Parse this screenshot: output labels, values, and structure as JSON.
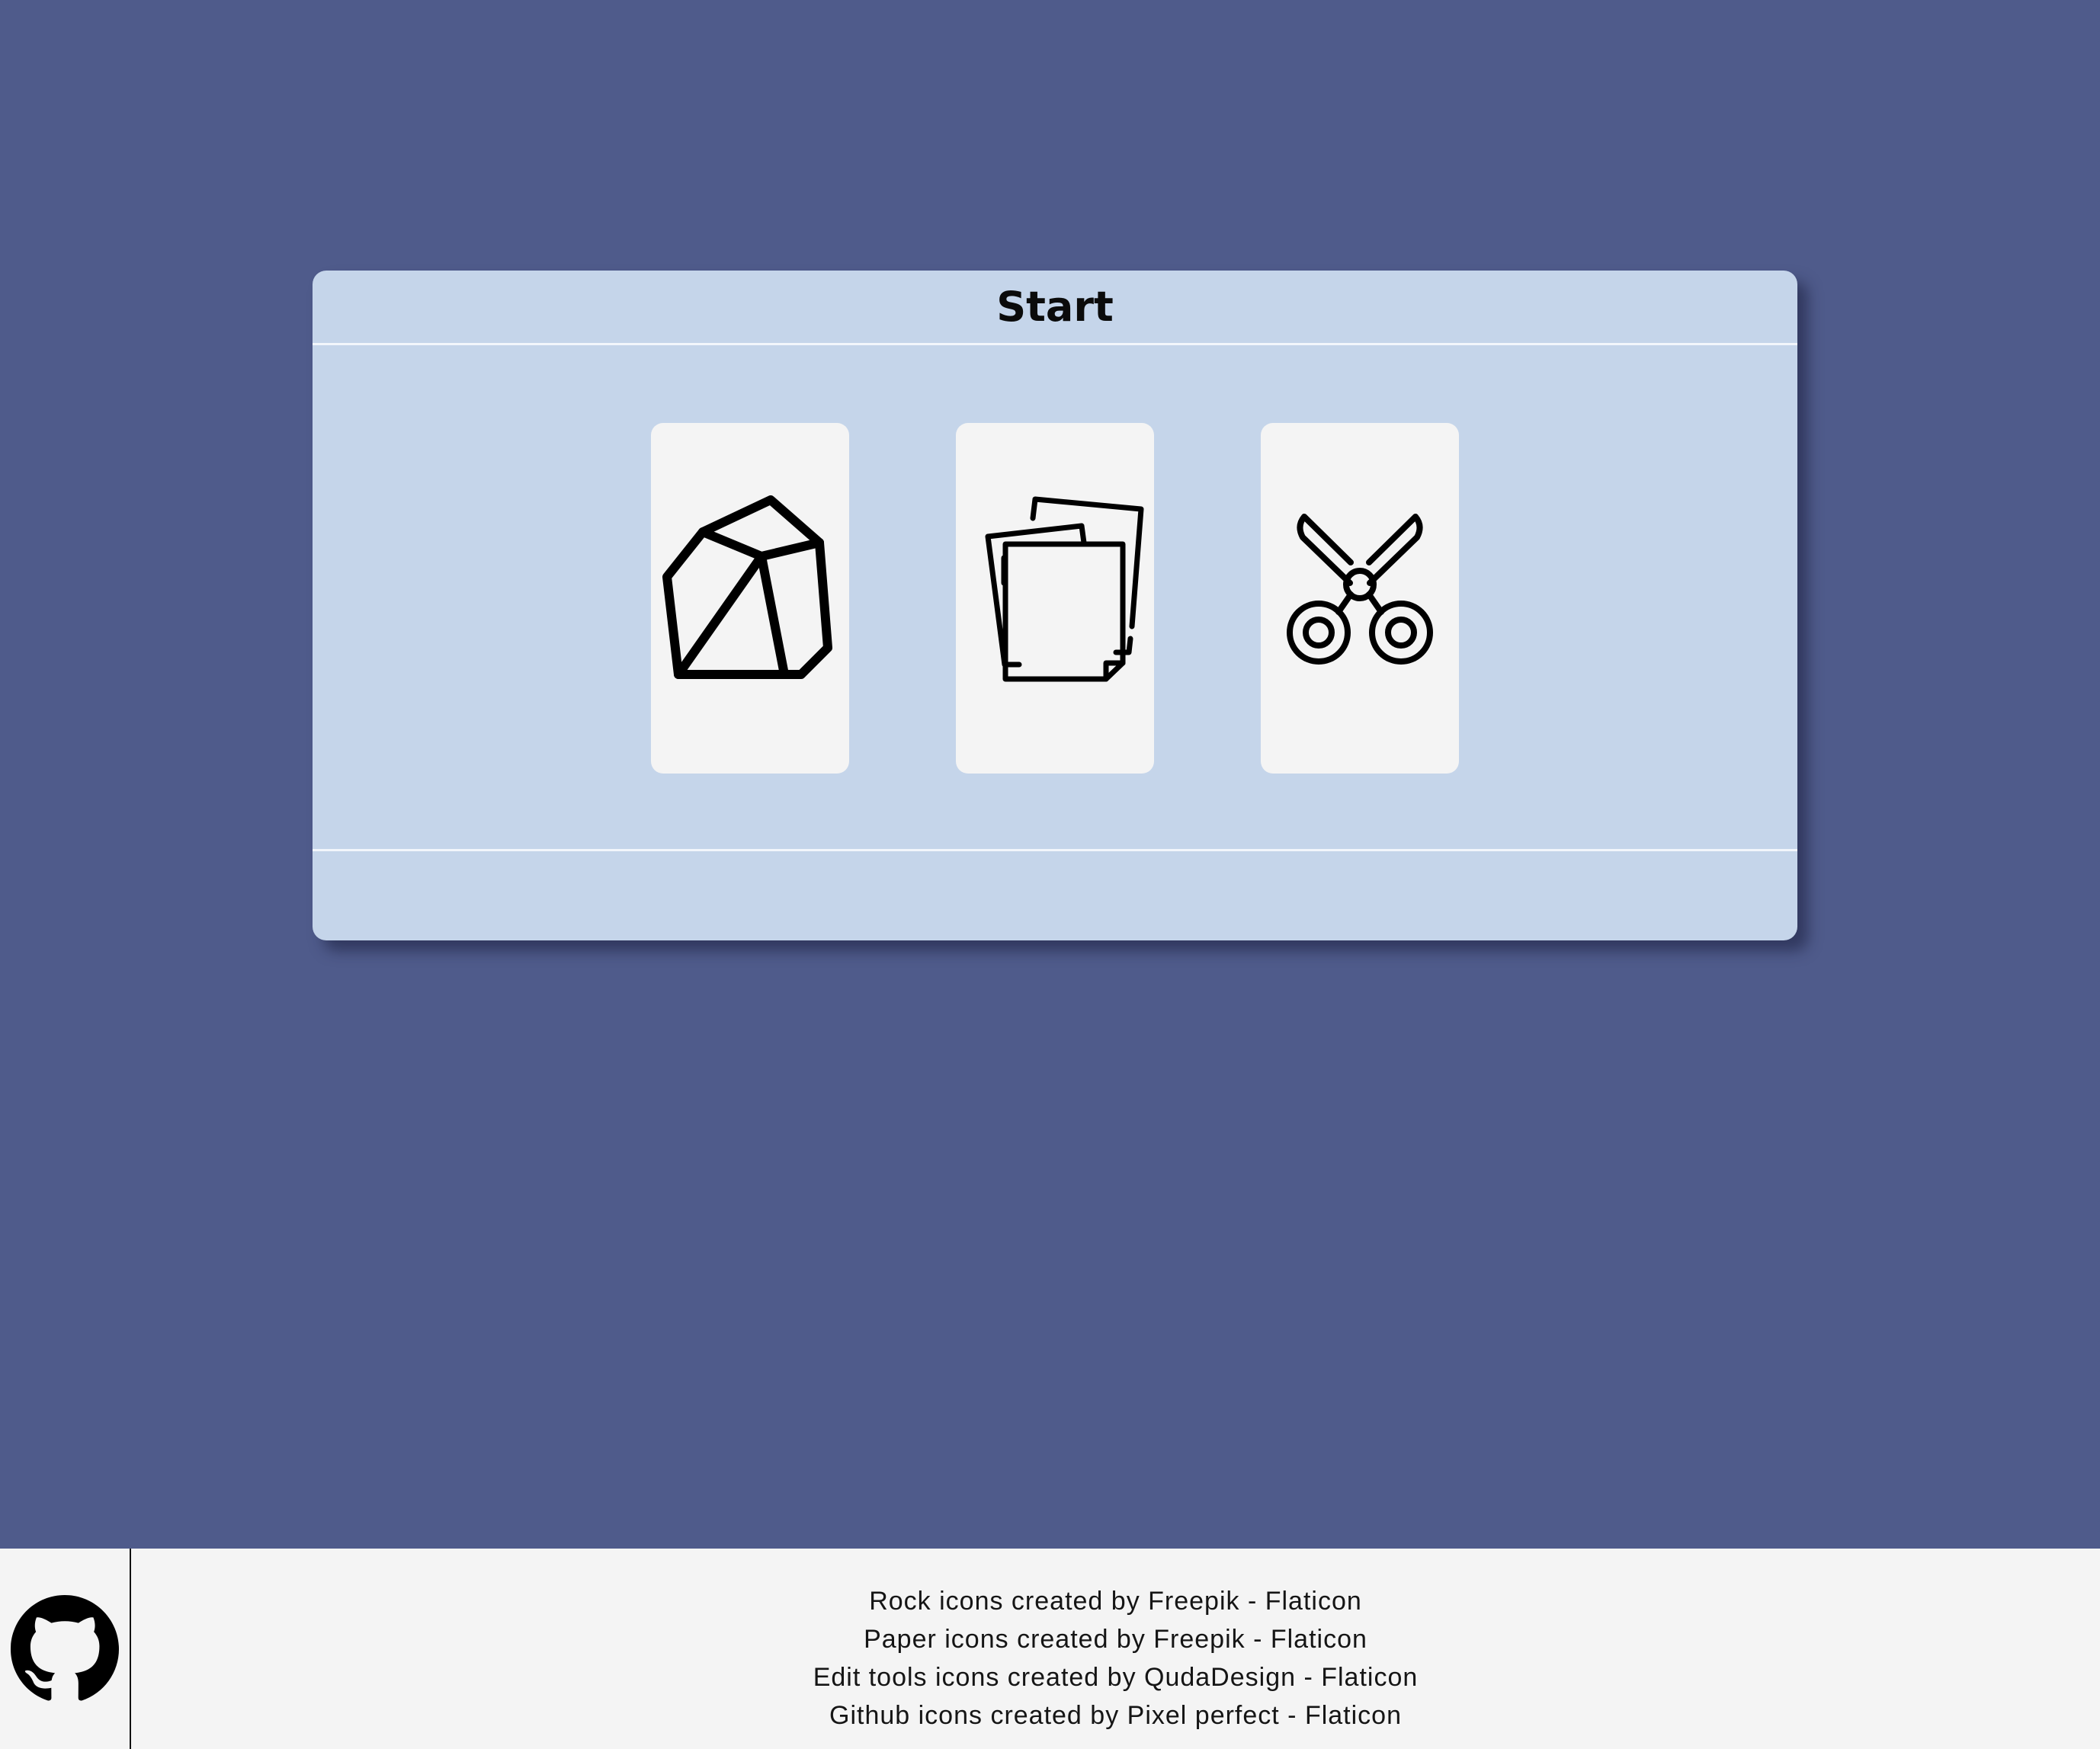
{
  "game": {
    "title": "Start",
    "result": "",
    "choices": [
      {
        "id": "rock",
        "icon": "rock-icon"
      },
      {
        "id": "paper",
        "icon": "paper-icon"
      },
      {
        "id": "scissors",
        "icon": "scissors-icon"
      }
    ]
  },
  "footer": {
    "github_icon": "github-icon",
    "credits": [
      "Rock icons created by Freepik - Flaticon",
      "Paper icons created by Freepik - Flaticon",
      "Edit tools icons created by QudaDesign - Flaticon",
      "Github icons created by Pixel perfect - Flaticon"
    ]
  },
  "colors": {
    "background": "#4f5b8b",
    "panel": "#c5d5ea",
    "card": "#f4f4f4",
    "footer": "#f4f4f4"
  }
}
